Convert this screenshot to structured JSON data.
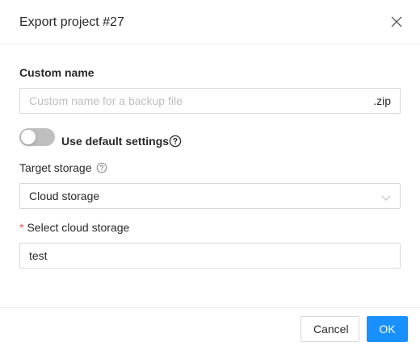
{
  "dialog": {
    "title": "Export project #27",
    "close_icon": "close-icon"
  },
  "custom_name": {
    "label": "Custom name",
    "value": "",
    "placeholder": "Custom name for a backup file",
    "suffix": ".zip"
  },
  "default_settings": {
    "label": "Use default settings",
    "enabled": false,
    "help_icon": "question-circle-icon"
  },
  "target_storage": {
    "label": "Target storage",
    "help_icon": "question-circle-icon",
    "selected": "Cloud storage",
    "arrow_icon": "chevron-down-icon"
  },
  "cloud_storage": {
    "required_mark": "*",
    "label": "Select cloud storage",
    "value": "test"
  },
  "footer": {
    "cancel_label": "Cancel",
    "ok_label": "OK"
  },
  "colors": {
    "primary": "#1890ff",
    "toggle_off": "#bfbfbf",
    "required": "#ff4d4f",
    "border": "#d9d9d9"
  }
}
